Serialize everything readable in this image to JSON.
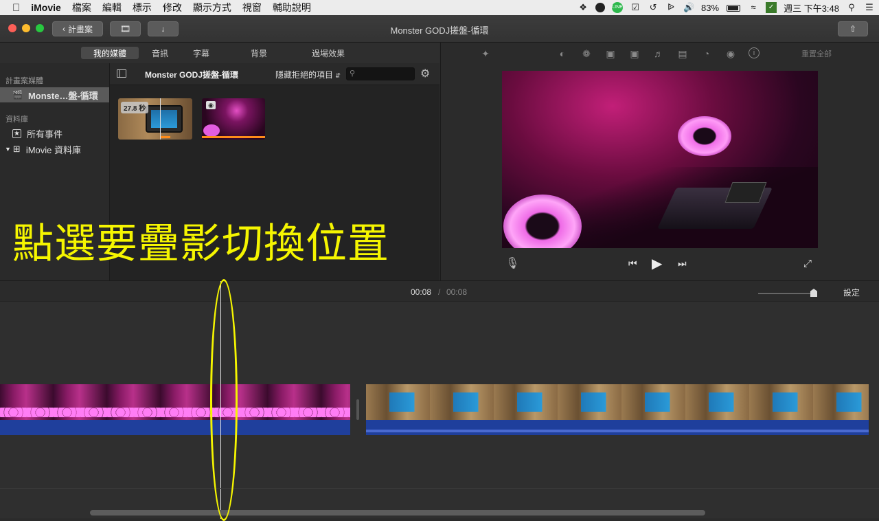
{
  "menubar": {
    "app_name": "iMovie",
    "items": [
      "檔案",
      "編輯",
      "標示",
      "修改",
      "顯示方式",
      "視窗",
      "輔助說明"
    ],
    "battery": "83%",
    "clock": "週三 下午3:48",
    "icons": [
      "apple-icon",
      "dropbox-icon",
      "qq-icon",
      "line-icon",
      "check-icon",
      "timemachine-icon",
      "bluetooth-icon",
      "volume-icon",
      "battery-icon",
      "wifi-icon",
      "input-icon",
      "search-icon",
      "list-icon"
    ]
  },
  "toolbar": {
    "back_label": "計畫案",
    "title": "Monster GODJ搓盤-循環",
    "colors": {
      "close": "#fc5f57",
      "minimize": "#fdbc2e",
      "zoom": "#28c840"
    }
  },
  "tabs": [
    {
      "label": "我的媒體",
      "active": true
    },
    {
      "label": "音訊",
      "active": false
    },
    {
      "label": "字幕",
      "active": false
    },
    {
      "label": "背景",
      "active": false
    },
    {
      "label": "過場效果",
      "active": false
    }
  ],
  "sidebar": {
    "projects_header": "計畫案媒體",
    "project_item": "Monste…盤-循環",
    "library_header": "資料庫",
    "all_events": "所有事件",
    "library_item": "iMovie 資料庫"
  },
  "browser": {
    "title": "Monster GODJ搓盤-循環",
    "filter": "隱藏拒絕的項目",
    "search_placeholder": "",
    "clip1_duration": "27.8 秒"
  },
  "viewer": {
    "reset_label": "重置全部"
  },
  "timeline": {
    "current_time": "00:08",
    "separator": "/",
    "total_time": "00:08",
    "settings_label": "設定"
  },
  "annotation": {
    "text": "點選要疊影切換位置",
    "color": "#f5f500"
  }
}
